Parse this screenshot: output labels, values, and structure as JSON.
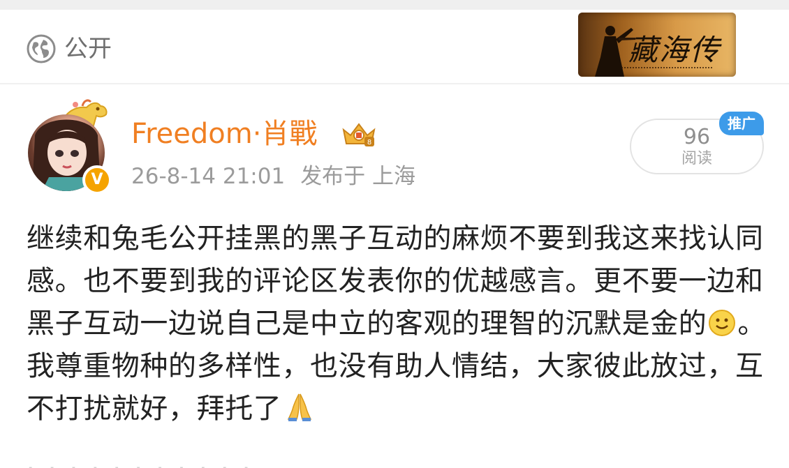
{
  "header": {
    "visibility_icon": "globe-icon",
    "visibility_label": "公开",
    "banner_title": "藏海传"
  },
  "post": {
    "author": {
      "name": "Freedom·肖戰",
      "verified_badge": "V",
      "avatar_icon": "avatar-image",
      "vip_icon": "vip-crown-icon"
    },
    "date": "26-8-14 21:01",
    "location": "发布于 上海",
    "views": {
      "count": "96",
      "label": "阅读",
      "promo_label": "推广"
    },
    "body": {
      "part1": "继续和兔毛公开挂黑的黑子互动的麻烦不要到我这来找认同感。也不要到我的评论区发表你的优越感言。更不要一边和黑子互动一边说自己是中立的客观的理智的沉默是金的",
      "part2": "。我尊重物种的多样性，也没有助人情结，大家彼此放过，互不打扰就好，拜托了",
      "emoji_1": "smile-emoji",
      "emoji_2": "pray-emoji"
    }
  },
  "colors": {
    "accent": "#f07f22",
    "meta_text": "#9b9b9b",
    "body_text": "#222222",
    "promo": "#3d9be9",
    "badge": "#f5a300"
  }
}
